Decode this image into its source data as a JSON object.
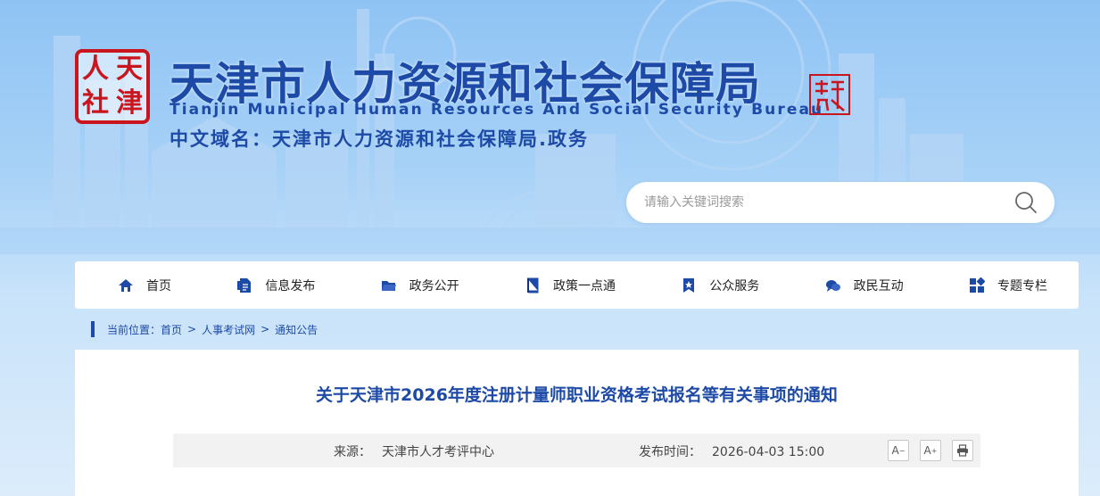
{
  "header": {
    "logo_chars": [
      "人",
      "天",
      "社",
      "津"
    ],
    "title_cn": "天津市人力资源和社会保障局",
    "title_en": "Tianjin Municipal Human Resources And Social Security Bureau",
    "domain_line": "中文域名：天津市人力资源和社会保障局.政务",
    "search_placeholder": "请输入关键词搜索"
  },
  "nav": {
    "items": [
      {
        "label": "首页",
        "icon": "home-icon"
      },
      {
        "label": "信息发布",
        "icon": "document-icon"
      },
      {
        "label": "政务公开",
        "icon": "folder-icon"
      },
      {
        "label": "政策一点通",
        "icon": "book-icon"
      },
      {
        "label": "公众服务",
        "icon": "bookmark-star-icon"
      },
      {
        "label": "政民互动",
        "icon": "chat-icon"
      },
      {
        "label": "专题专栏",
        "icon": "grid-icon"
      }
    ]
  },
  "breadcrumb": {
    "prefix": "当前位置：",
    "items": [
      "首页",
      "人事考试网",
      "通知公告"
    ],
    "separator": ">"
  },
  "article": {
    "title": "关于天津市2026年度注册计量师职业资格考试报名等有关事项的通知",
    "source_label": "来源：",
    "source": "天津市人才考评中心",
    "time_label": "发布时间：",
    "time": "2026-04-03 15:00",
    "tools": {
      "font_decrease": "A",
      "font_increase": "A"
    }
  },
  "colors": {
    "brand_blue": "#1d4aa6",
    "seal_red": "#c9151e"
  }
}
